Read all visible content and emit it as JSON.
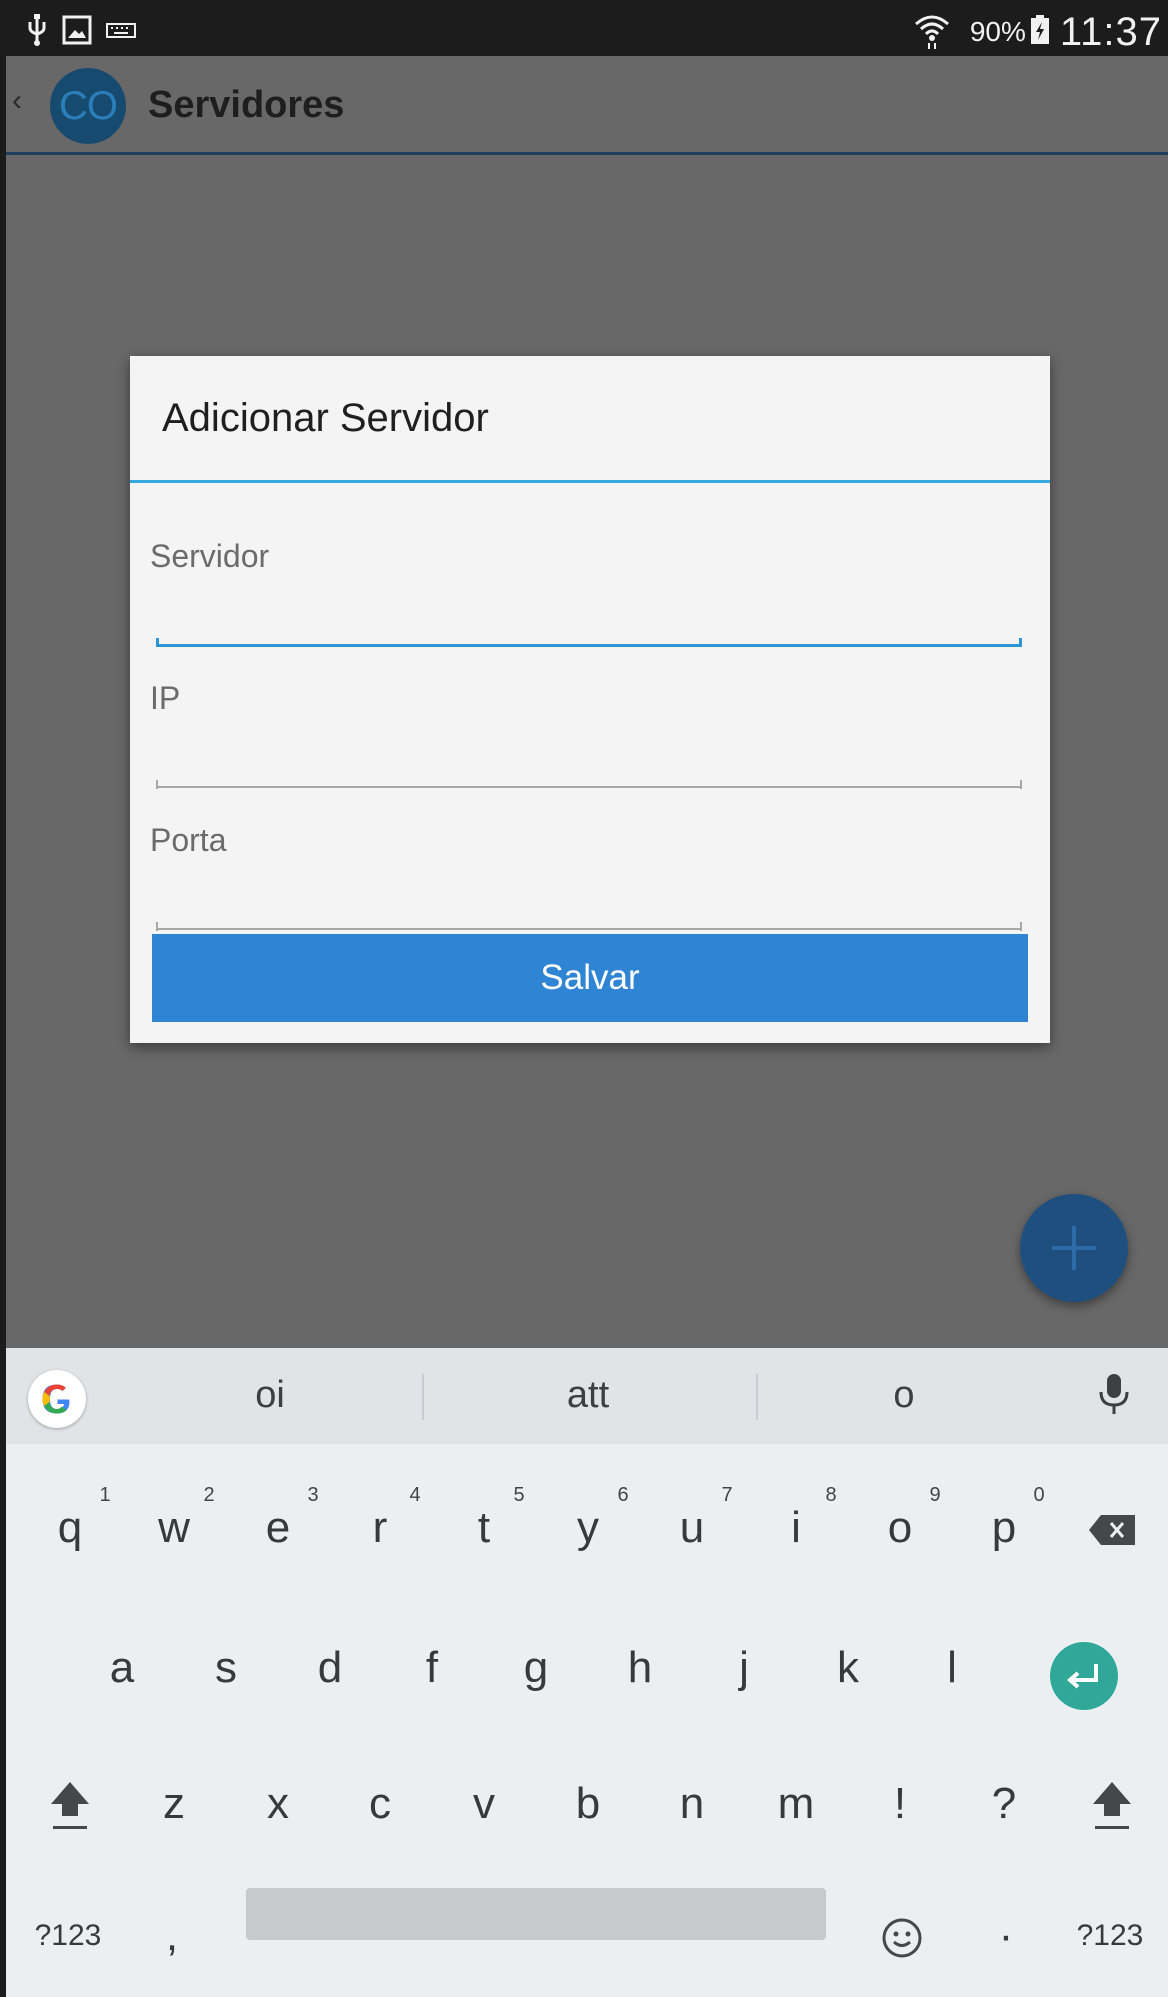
{
  "status_bar": {
    "icons_left": [
      "usb-icon",
      "image-icon",
      "keyboard-icon"
    ],
    "icons_right": [
      "wifi-icon",
      "battery-icon"
    ],
    "battery": "90%",
    "time": "11:37"
  },
  "app_bar": {
    "logo_text": "CO",
    "title": "Servidores"
  },
  "dialog": {
    "title": "Adicionar Servidor",
    "fields": [
      {
        "label": "Servidor",
        "value": "",
        "focused": true
      },
      {
        "label": "IP",
        "value": "",
        "focused": false
      },
      {
        "label": "Porta",
        "value": "",
        "focused": false
      }
    ],
    "save_label": "Salvar"
  },
  "fab": {
    "icon": "plus-icon"
  },
  "keyboard": {
    "suggestions": [
      "oi",
      "att",
      "o"
    ],
    "row1": [
      "q",
      "w",
      "e",
      "r",
      "t",
      "y",
      "u",
      "i",
      "o",
      "p"
    ],
    "row1_hints": [
      "1",
      "2",
      "3",
      "4",
      "5",
      "6",
      "7",
      "8",
      "9",
      "0"
    ],
    "row2": [
      "a",
      "s",
      "d",
      "f",
      "g",
      "h",
      "j",
      "k",
      "l"
    ],
    "row3": [
      "z",
      "x",
      "c",
      "v",
      "b",
      "n",
      "m",
      "!",
      "?"
    ],
    "bottom": {
      "symbols_left": "?123",
      "comma": ",",
      "period": "·",
      "symbols_right": "?123"
    },
    "colors": {
      "background": "#eceff1",
      "enter": "#2fa899"
    }
  },
  "colors": {
    "accent": "#2f85d3",
    "divider": "#36a9df",
    "fab": "#1f4f7e"
  }
}
